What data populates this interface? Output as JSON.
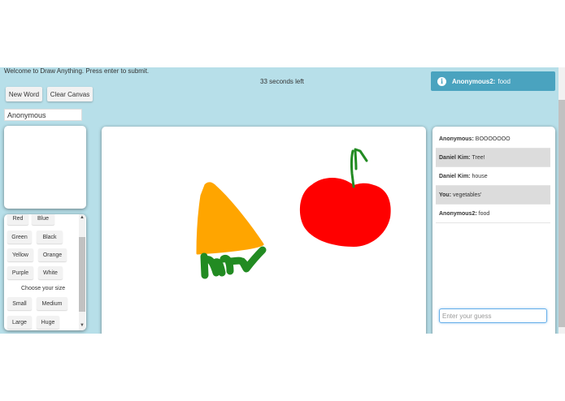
{
  "header": {
    "welcome": "Welcome to Draw Anything. Press enter to submit.",
    "timer": "33 seconds left"
  },
  "toast": {
    "user": "Anonymous2:",
    "text": "food",
    "icon": "info-icon"
  },
  "toolbar": {
    "new_word": "New Word",
    "clear_canvas": "Clear Canvas"
  },
  "name_field": {
    "value": "Anonymous"
  },
  "palette": {
    "colors": [
      "Red",
      "Blue",
      "Green",
      "Black",
      "Yellow",
      "Orange",
      "Purple",
      "White"
    ],
    "size_label": "Choose your size",
    "sizes": [
      "Small",
      "Medium",
      "Large",
      "Huge"
    ]
  },
  "chat": {
    "messages": [
      {
        "user": "Anonymous:",
        "text": "BOOOOOOO"
      },
      {
        "user": "Daniel Kim:",
        "text": "Tree!"
      },
      {
        "user": "Daniel Kim:",
        "text": "house"
      },
      {
        "user": "You:",
        "text": "vegetables'"
      },
      {
        "user": "Anonymous2:",
        "text": "food"
      }
    ],
    "guess_placeholder": "Enter your guess"
  },
  "colors": {
    "background": "#b7dfe9",
    "toast": "#4aa3bf",
    "carrot_orange": "#ffa500",
    "carrot_green": "#228b22",
    "apple_red": "#ff0000"
  }
}
